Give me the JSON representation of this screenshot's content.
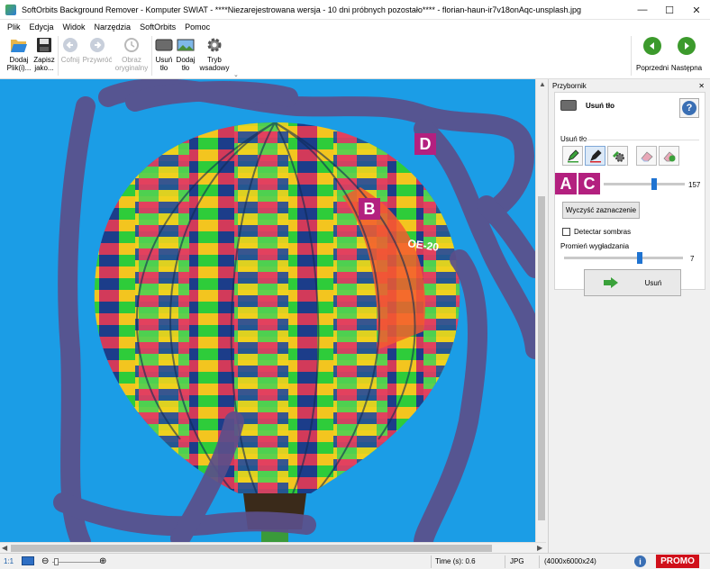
{
  "window": {
    "title": "SoftOrbits Background Remover - Komputer SWIAT - ****Niezarejestrowana wersja - 10 dni próbnych pozostało**** - florian-haun-ir7v18onAqc-unsplash.jpg",
    "controls": {
      "minimize": "—",
      "maximize": "☐",
      "close": "✕"
    }
  },
  "menu": [
    "Plik",
    "Edycja",
    "Widok",
    "Narzędzia",
    "SoftOrbits",
    "Pomoc"
  ],
  "ribbon": {
    "buttons": [
      {
        "id": "add-file",
        "label1": "Dodaj",
        "label2": "Plik(i)...",
        "icon": "folder-open-icon",
        "enabled": true
      },
      {
        "id": "save-as",
        "label1": "Zapisz",
        "label2": "jako...",
        "icon": "floppy-icon",
        "enabled": true
      },
      {
        "id": "undo",
        "label1": "Cofnij",
        "label2": "",
        "icon": "undo-icon",
        "enabled": false
      },
      {
        "id": "redo",
        "label1": "Przywróć",
        "label2": "",
        "icon": "redo-icon",
        "enabled": false
      },
      {
        "id": "original",
        "label1": "Obraz",
        "label2": "oryginalny",
        "icon": "clock-icon",
        "enabled": false
      },
      {
        "id": "remove-bg",
        "label1": "Usuń",
        "label2": "tło",
        "icon": "remove-bg-icon",
        "enabled": true
      },
      {
        "id": "add-bg",
        "label1": "Dodaj",
        "label2": "tło",
        "icon": "add-bg-icon",
        "enabled": true
      },
      {
        "id": "batch",
        "label1": "Tryb",
        "label2": "wsadowy",
        "icon": "gear-icon",
        "enabled": true
      }
    ],
    "nav": {
      "prev": "Poprzedni",
      "next": "Następna"
    }
  },
  "canvas": {
    "markers": {
      "B": "B",
      "D": "D"
    },
    "balloon_text": "OE-20"
  },
  "toolbox": {
    "title": "Przybornik",
    "tool_name": "Usuń tło",
    "help": "?",
    "group_label": "Usuń tło",
    "markers": {
      "A": "A",
      "C": "C"
    },
    "brush_size": "157",
    "brush_size_fraction": 0.62,
    "clear_button": "Wyczyść zaznaczenie",
    "shadow_label": "Detectar sombras",
    "shadow_checked": false,
    "smooth_label": "Promień wygładzania",
    "smooth_value": "7",
    "smooth_fraction": 0.64,
    "remove_button": "Usuń"
  },
  "status": {
    "zoom": "1:1",
    "time": "Time (s): 0.6",
    "format": "JPG",
    "dims": "(4000x6000x24)",
    "promo": "PROMO"
  },
  "colors": {
    "canvas_bg": "#1b9de6",
    "stroke": "#5b4f8a",
    "marker": "#b3207f",
    "accent_green": "#3c9a2c",
    "promo": "#d0101a"
  }
}
